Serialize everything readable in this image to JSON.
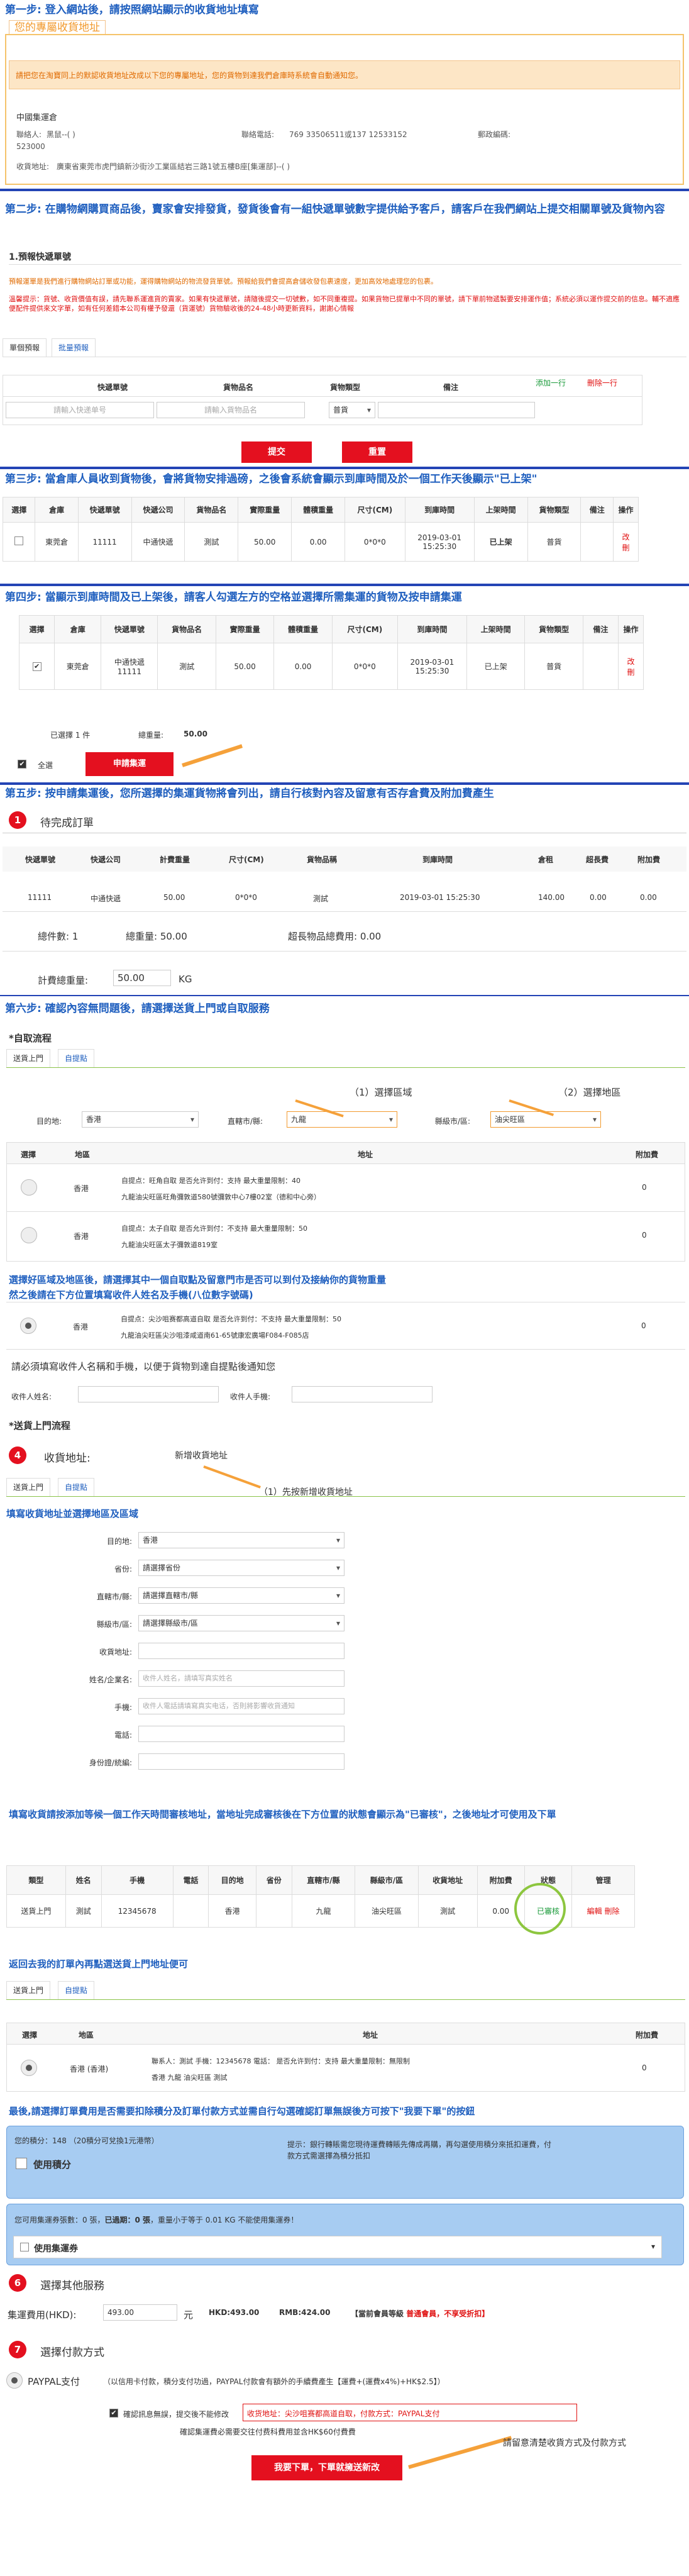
{
  "step1": {
    "title": "第一步: 登入網站後，請按照網站顯示的收貨地址填寫",
    "subtitle": "您的專屬收貨地址",
    "notice": "請把您在淘寶同上的默認收貨地址改成以下您的專屬地址，您的貨物到達我們倉庫時系統會自動通知您。",
    "warehouse": "中國集運倉",
    "contact_label": "聯絡人:",
    "contact_value": "黑鼠--(            )",
    "phone_label": "聯絡電話:",
    "phone_value": "769 33506511或137 12533152",
    "zip_label": "郵政編碼:",
    "zip_value": "523000",
    "addr_label": "收貨地址:",
    "addr_value": "廣東省東莞市虎門鎮新沙街沙工業區結岩三路1號五樓B座[集運部]--(        )"
  },
  "step2": {
    "title": "第二步: 在購物網購買商品後，賣家會安排發貨，發貨後會有一組快遞單號數字提供給予客戶，請客戶在我們網站上提交相關單號及貨物內容",
    "section": "1.預報快遞單號",
    "tip1": "預報運單是我們進行購物網站訂單或功能，運得購物網站的物流發貨單號。預報給我們會提高倉儲收發包裹速度，更加高效地處理您的包裹。",
    "tip2": "溫馨提示：貨號、收貨價值有誤，請先聯系運進貨的賣家。如果有快遞單號，請隨後提交一切號數，如不同重複提。如果貨物已提單中不同的單號，請下單前物遞製要安排運作值；系統必須以運作提交前的信息。輔不適應便配件提供來文字單，如有任何差錯本公司有權予發還（貨運號）貨物驗收後的24-48小時更新資料，謝謝心情報",
    "tabs": [
      "單個預報",
      "批量預報"
    ],
    "headers": [
      "快遞單號",
      "貨物品名",
      "貨物類型",
      "備注"
    ],
    "placeholder_tracking": "請輸入快递单号",
    "placeholder_item": "請輸入貨物品名",
    "type_value": "普貨",
    "add_row": "添加一行",
    "del_row": "刪除一行",
    "submit": "提交",
    "reset": "重置"
  },
  "step3": {
    "title": "第三步: 當倉庫人員收到貨物後，會將貨物安排過磅，之後會系統會顯示到庫時間及於一個工作天後顯示\"已上架\"",
    "headers": [
      "選擇",
      "倉庫",
      "快遞單號",
      "快遞公司",
      "貨物品名",
      "實際重量",
      "體積重量",
      "尺寸(CM)",
      "到庫時間",
      "上架時間",
      "貨物類型",
      "備注",
      "操作"
    ],
    "row": [
      "",
      "東莞倉",
      "11111",
      "中通快遞",
      "測試",
      "50.00",
      "0.00",
      "0*0*0",
      "2019-03-01 15:25:30",
      "已上架",
      "普貨",
      "",
      "改 刪"
    ]
  },
  "step4": {
    "title": "第四步: 當顯示到庫時間及已上架後，請客人勾選左方的空格並選擇所需集運的貨物及按申請集運",
    "headers": [
      "選擇",
      "倉庫",
      "快遞單號",
      "貨物品名",
      "實際重量",
      "體積重量",
      "尺寸(CM)",
      "到庫時間",
      "上架時間",
      "貨物類型",
      "備注",
      "操作"
    ],
    "row": [
      "✔",
      "東莞倉",
      "中通快遞 11111",
      "測試",
      "50.00",
      "0.00",
      "0*0*0",
      "2019-03-01 15:25:30",
      "已上架",
      "普貨",
      "",
      "改 刪"
    ],
    "selected": "已選擇 1 件",
    "total_weight_label": "總重量:",
    "total_weight": "50.00",
    "select_all": "全選",
    "apply": "申請集運"
  },
  "step5": {
    "title": "第五步: 按申請集運後，您所選擇的集運貨物將會列出，請自行核對內容及留意有否存倉費及附加費產生",
    "num": "1",
    "heading": "待完成訂單",
    "headers": [
      "快遞單號",
      "快遞公司",
      "計費重量",
      "尺寸(CM)",
      "貨物品稱",
      "到庫時間",
      "倉租",
      "超長費",
      "附加費"
    ],
    "row": [
      "11111",
      "中通快遞",
      "50.00",
      "0*0*0",
      "測試",
      "2019-03-01 15:25:30",
      "140.00",
      "0.00",
      "0.00"
    ],
    "total_pieces": "總件數:  1",
    "total_weight": "總重量: 50.00",
    "long_total": "超長物品總費用:  0.00",
    "bill_weight_label": "計費總重量:",
    "bill_weight": "50.00",
    "kg": "KG"
  },
  "step6": {
    "title": "第六步: 確認內容無問題後，請選擇送貨上門或自取服務",
    "selfpick": "*自取流程",
    "tabs": [
      "送貨上門",
      "自提點"
    ],
    "dest_label": "目的地:",
    "dest_value": "香港",
    "city_label": "直轄市/縣:",
    "city_value": "九龍",
    "district_label": "縣級市/區:",
    "district_value": "油尖旺區",
    "ann1": "（1）選擇區域",
    "ann2": "（2）選擇地區",
    "headers": [
      "選擇",
      "地區",
      "地址",
      "附加費"
    ],
    "rows": [
      {
        "area": "香港",
        "addr1": "自提点：旺角自取  是否允许到付：支持  最大重量限制：40",
        "addr2": "九龍油尖旺區旺角彌敦道580號彌敦中心7樓02室（德和中心旁）",
        "fee": "0"
      },
      {
        "area": "香港",
        "addr1": "自提点：太子自取  是否允许到付：不支持  最大重量限制：50",
        "addr2": "九龍油尖旺區太子彌敦道819室",
        "fee": "0"
      }
    ],
    "note1": "選擇好區域及地區後，請選擇其中一個自取點及留意門市是否可以到付及接納你的貨物重量",
    "note2": "然之後請在下方位置填寫收件人姓名及手機(八位數字號碼)",
    "row3": {
      "area": "香港",
      "addr1": "自提点：尖沙咀赛都高道自取  是否允许到付：不支持  最大重量限制：50",
      "addr2": "九龍油尖旺區尖沙咀漆咸道南61-65號康宏廣場F084-F085店",
      "fee": "0"
    },
    "name_note": "請必須填寫收件人名稱和手機，以便于貨物到達自提點後通知您",
    "receiver_label": "收件人姓名:",
    "phone_label": "收件人手機:"
  },
  "delivery": {
    "title": "*送貨上門流程",
    "num": "4",
    "heading": "收貨地址:",
    "new_addr": "新增收貨地址",
    "ann": "（1）先按新增收貨地址",
    "tabs": [
      "送貨上門",
      "自提點"
    ],
    "form_title": "填寫收貨地址並選擇地區及區域",
    "fields": [
      {
        "label": "目的地:",
        "value": "香港",
        "kind": "select"
      },
      {
        "label": "省份:",
        "value": "請選擇省份",
        "kind": "select"
      },
      {
        "label": "直轄市/縣:",
        "value": "請選擇直轄市/縣",
        "kind": "select"
      },
      {
        "label": "縣級市/區:",
        "value": "請選擇縣級市/區",
        "kind": "select"
      },
      {
        "label": "收貨地址:",
        "value": "",
        "kind": "input"
      },
      {
        "label": "姓名/企業名:",
        "value": "收件人姓名，請填写真实姓名",
        "kind": "input"
      },
      {
        "label": "手機:",
        "value": "收件人電話請填寫真实电话，否則將影響收貨通知",
        "kind": "input"
      },
      {
        "label": "電話:",
        "value": "",
        "kind": "input"
      },
      {
        "label": "身份證/統編:",
        "value": "",
        "kind": "input"
      }
    ],
    "note": "填寫收貨請按添加等候一個工作天時間審核地址，當地址完成審核後在下方位置的狀態會顯示為\"已審核\"，之後地址才可使用及下單",
    "headers": [
      "類型",
      "姓名",
      "手機",
      "電話",
      "目的地",
      "省份",
      "直轄市/縣",
      "縣級市/區",
      "收貨地址",
      "附加費",
      "狀態",
      "管理"
    ],
    "row": [
      "送貨上門",
      "測試",
      "12345678",
      "",
      "香港",
      "",
      "九龍",
      "油尖旺區",
      "測試",
      "0.00",
      "已審核",
      ""
    ],
    "edit": "編輯",
    "delete": "刪除",
    "back_note": "返回去我的訂單內再點選送貨上門地址便可",
    "tabs2": [
      "送貨上門",
      "自提點"
    ],
    "headers2": [
      "選擇",
      "地區",
      "地址",
      "附加費"
    ],
    "row2": {
      "area": "香港 (香港)",
      "addr1": "聯系人：測試  手機：12345678  電話：  是否允许到付：支持  最大重量限制：無限制",
      "addr2": "香港 九龍 油尖旺區 測試",
      "fee": "0"
    }
  },
  "final": {
    "title": "最後,請選擇訂單費用是否需要扣除積分及訂單付款方式並需自行勾選確認訂單無誤後方可按下\"我要下單\"的按鈕",
    "points_line": "您的積分：148  （20積分可兌換1元港幣）",
    "use_points": "使用積分",
    "points_tip": "提示：銀行轉賬需您現待運費轉賬先傳成再購，再勾選使用積分來抵扣運費，付款方式需選擇為積分抵扣",
    "coupon_line1": "您可用集運券張數：0 張，",
    "coupon_line2": "已過期：0 張",
    "coupon_line3": "，重量小于等于 0.01 KG 不能使用集運券！",
    "use_coupon": "使用集運券",
    "num6": "6",
    "other": "選擇其他服務",
    "fee_label": "集運費用(HKD):",
    "fee_value": "493.00",
    "yuan": "元",
    "hkd": "HKD:493.00",
    "rmb": "RMB:424.00",
    "member": "【當前會員等級",
    "member_level": "普通會員",
    "member_tail": "，不享受折扣】",
    "num7": "7",
    "pay": "選擇付款方式",
    "paypal": "PAYPAL支付",
    "paypal_note": "（以信用卡付款，積分支付功過，PAYPAL付款會有額外的手續費產生【運費+(運費x4%)+HK$2.5】）",
    "confirm_label": "確認訊息無誤，提交後不能修改",
    "confirm_value": "收货地址：尖沙咀赛都高道自取，付款方式：PAYPAL支付",
    "confirm_line2": "確認集運費必需要交往付费科費用並含HK$60付費費",
    "submit": "我要下單，下單就擁送新改",
    "bottom_ann": "請留意清楚收貨方式及付款方式"
  }
}
